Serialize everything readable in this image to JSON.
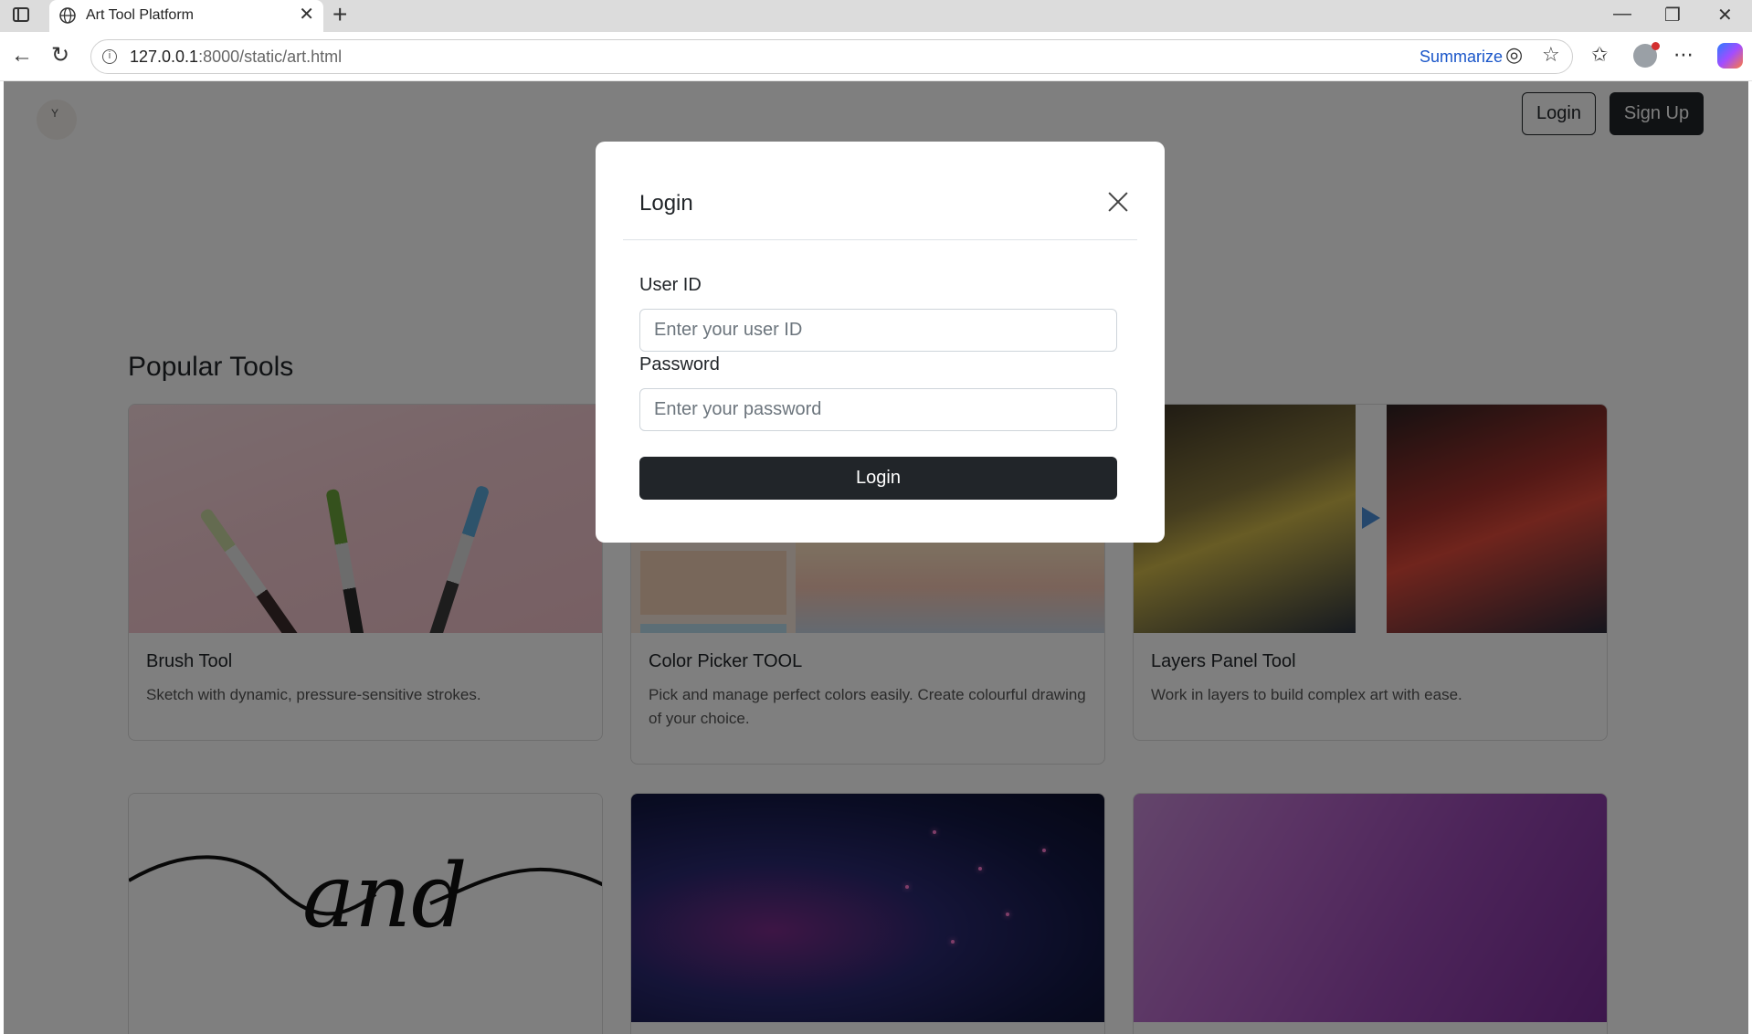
{
  "browser": {
    "tab_title": "Art Tool Platform",
    "url_host": "127.0.0.1",
    "url_path": ":8000/static/art.html",
    "summarize_label": "Summarize"
  },
  "header": {
    "login_label": "Login",
    "signup_label": "Sign Up"
  },
  "main": {
    "section_title": "Popular Tools",
    "cards": [
      {
        "title": "Brush Tool",
        "text": "Sketch with dynamic, pressure-sensitive strokes."
      },
      {
        "title": "Color Picker TOOL",
        "text": "Pick and manage perfect colors easily. Create colourful drawing of your choice."
      },
      {
        "title": "Layers Panel Tool",
        "text": "Work in layers to build complex art with ease."
      },
      {
        "title": "",
        "text": "",
        "image_text": "and"
      },
      {
        "title": "",
        "text": ""
      },
      {
        "title": "",
        "text": ""
      }
    ]
  },
  "modal": {
    "title": "Login",
    "user_id_label": "User ID",
    "user_id_placeholder": "Enter your user ID",
    "user_id_value": "",
    "password_label": "Password",
    "password_placeholder": "Enter your password",
    "password_value": "",
    "submit_label": "Login"
  },
  "colors": {
    "primary_dark": "#212529",
    "link_blue": "#1a56c9",
    "backdrop": "rgba(0,0,0,0.5)"
  }
}
